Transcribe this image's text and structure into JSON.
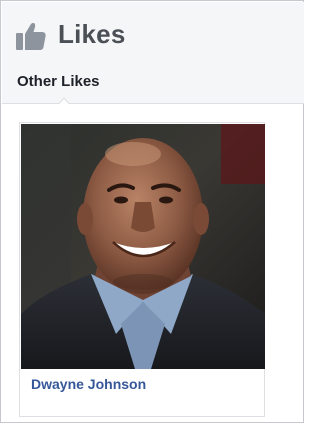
{
  "header": {
    "icon": "thumbs-up-icon",
    "title": "Likes"
  },
  "tabs": [
    {
      "label": "Other Likes",
      "active": true
    }
  ],
  "likes": [
    {
      "name": "Dwayne Johnson",
      "image": "person-portrait"
    }
  ],
  "colors": {
    "header_bg": "#f5f6f7",
    "title": "#4b4f56",
    "link": "#365899",
    "border": "#dddfe2"
  }
}
